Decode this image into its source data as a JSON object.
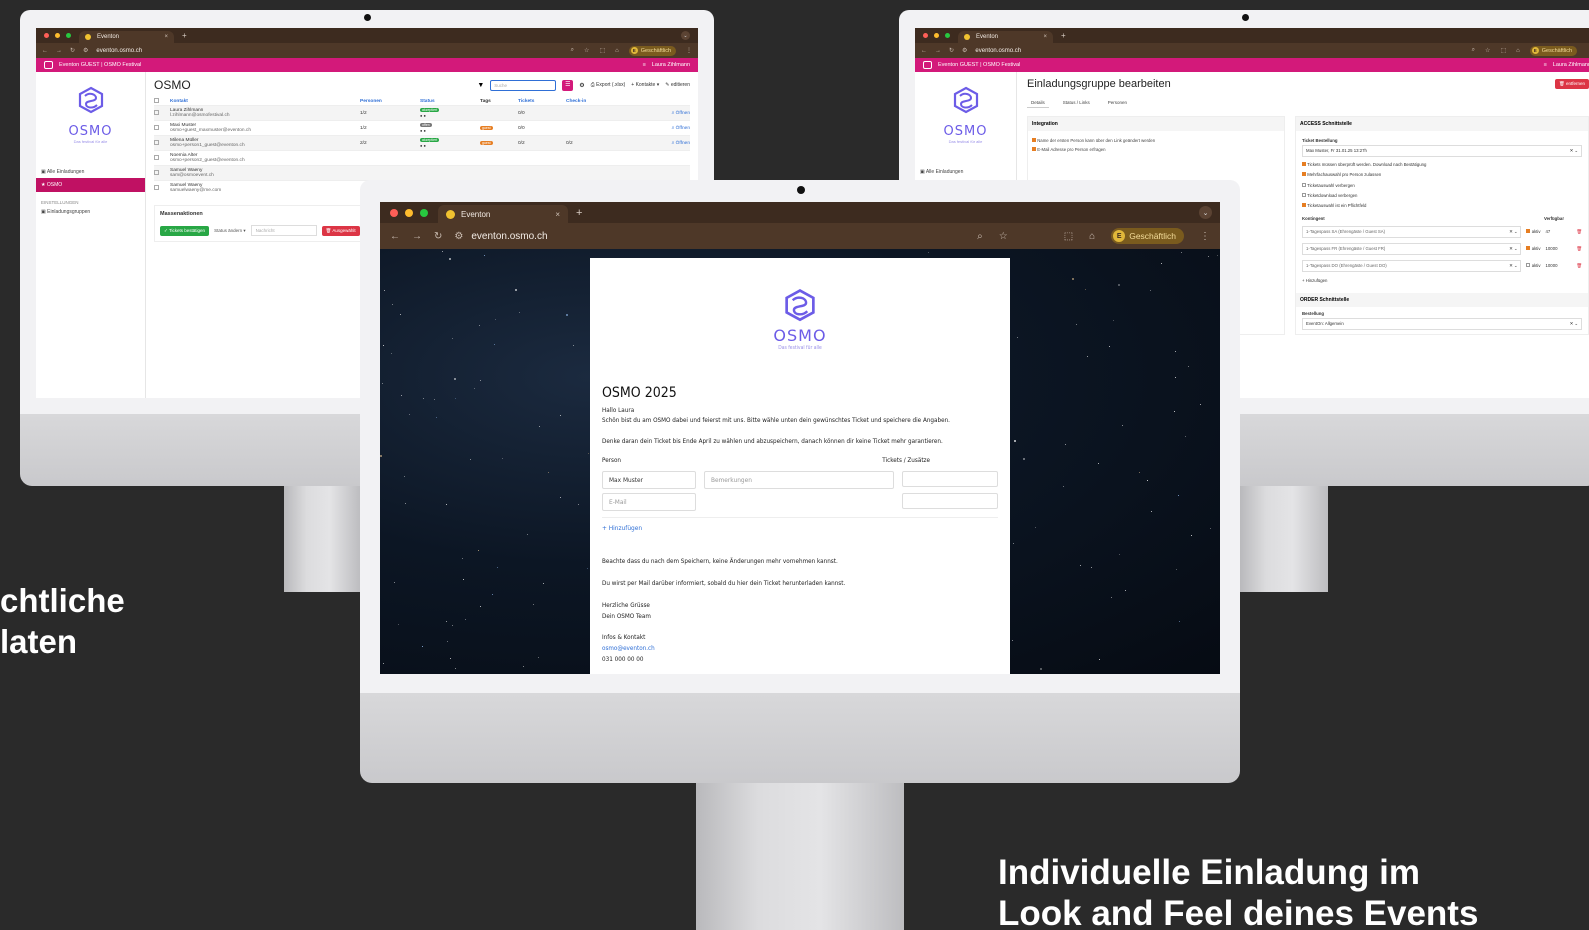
{
  "headlines": {
    "left_line1": "chtliche",
    "left_line2": "laten",
    "right_line1": "Individuelle Einladung im",
    "right_line2": "Look and Feel deines Events"
  },
  "browser": {
    "tab_title": "Eventon",
    "url": "eventon.osmo.ch",
    "profile_initial": "E",
    "profile_label": "Geschäftlich",
    "new_tab": "+",
    "close": "×"
  },
  "app": {
    "title": "Eventon GUEST | OSMO Festival",
    "user": "Laura Zihlmann",
    "logo_text": "OSMO",
    "logo_tagline": "Das festival für alle"
  },
  "left": {
    "menu": {
      "all_invites": "Alle Einladungen",
      "active_item": "OSMO",
      "settings_header": "EINSTELLUNGEN",
      "groups": "Einladungsgruppen"
    },
    "page_title": "OSMO",
    "search_placeholder": "Suche",
    "export_label": "Export (.xlsx)",
    "contacts_label": "Kontakte",
    "edit_label": "editieren",
    "columns": [
      "Kontakt",
      "Personen",
      "Status",
      "Tags",
      "Tickets",
      "Check-in"
    ],
    "rows": [
      {
        "name": "Laura Zihlmann",
        "email": "l.zihlmann@osmofestival.ch",
        "persons": "1/2",
        "status": "akzeptiert",
        "tag": "",
        "tickets": "0/0",
        "checkin": "",
        "action": "Öffnen"
      },
      {
        "name": "Maxi Muster",
        "email": "osmo+guest_maxmuster@eventon.ch",
        "persons": "1/2",
        "status": "offen",
        "tag": "guest",
        "tickets": "0/0",
        "checkin": "",
        "action": "Öffnen"
      },
      {
        "name": "Milena Müller",
        "email": "osmo+person1_guest@eventon.ch",
        "persons": "2/2",
        "status": "akzeptiert",
        "tag": "guest",
        "tickets": "0/2",
        "checkin": "0/2",
        "action": "Öffnen"
      },
      {
        "name": "Noemia Alter",
        "email": "osmo+person2_guest@eventon.ch",
        "persons": "",
        "status": "",
        "tag": "",
        "tickets": "",
        "checkin": "",
        "action": ""
      },
      {
        "name": "Samuel Waeny",
        "email": "sam@osmoevent.ch",
        "persons": "",
        "status": "",
        "tag": "",
        "tickets": "",
        "checkin": "",
        "action": ""
      },
      {
        "name": "Samuel Waeny",
        "email": "samuelwaeny@me.com",
        "persons": "",
        "status": "",
        "tag": "",
        "tickets": "",
        "checkin": "",
        "action": ""
      }
    ],
    "bulk_title": "Massenaktionen",
    "bulk_confirm": "Tickets bestätigen",
    "bulk_status": "Status ändern",
    "bulk_placeholder": "Nachricht",
    "bulk_delete": "Ausgewählt"
  },
  "right": {
    "menu_all": "Alle Einladungen",
    "page_title": "Einladungsgruppe bearbeiten",
    "remove_label": "entfernen",
    "tabs": [
      "Details",
      "Status / Links",
      "Personen"
    ],
    "integration_title": "Integration",
    "integration_opt1": "Name der ersten Person kann über den Link geändert werden",
    "integration_opt2": "E-Mail Adresse pro Person erfragen",
    "access_title": "ACCESS Schnittstelle",
    "ticket_order_label": "Ticket Bestellung",
    "ticket_order_value": "Max Muster, Fr 31.01.25 13:27h",
    "access_opts": [
      {
        "label": "Tickets müssen überprüft werden. Download nach Bestätigung",
        "checked": true
      },
      {
        "label": "Mehrfachauswahl pro Person zulassen",
        "checked": true
      },
      {
        "label": "Ticketauswahl verbergen",
        "checked": false
      },
      {
        "label": "Ticketdownload verbergen",
        "checked": false
      },
      {
        "label": "Ticketauswahl ist ein Pflichtfeld",
        "checked": true
      }
    ],
    "quota_col": "Kontingent",
    "avail_col": "Verfügbar",
    "quotas": [
      {
        "name": "1-Tagespass SA (Ehrengäste / Guest SA)",
        "active": true,
        "active_label": "aktiv",
        "avail": "47"
      },
      {
        "name": "1-Tagespass FR (Ehrengäste / Guest FR)",
        "active": true,
        "active_label": "aktiv",
        "avail": "10000"
      },
      {
        "name": "1-Tagespass DO (Ehrengäste / Guest DO)",
        "active": false,
        "active_label": "aktiv",
        "avail": "10000"
      }
    ],
    "add_label": "+ Hinzufügen",
    "order_title": "ORDER Schnittstelle",
    "order_label": "Bestellung",
    "order_value": "EventOn: Allgemein"
  },
  "invite": {
    "logo_text": "OSMO",
    "logo_tagline": "Das festival für alle",
    "title": "OSMO 2025",
    "greeting": "Hallo Laura",
    "intro": "Schön bist du am OSMO dabei und feierst mit uns. Bitte wähle unten dein gewünschtes Ticket und speichere die Angaben.",
    "deadline": "Denke daran dein Ticket bis Ende April zu wählen und abzuspeichern, danach können dir keine Ticket mehr garantieren.",
    "col_person": "Person",
    "col_tickets": "Tickets / Zusätze",
    "name_value": "Max Muster",
    "remarks_placeholder": "Bemerkungen",
    "email_placeholder": "E-Mail",
    "add_link": "+ Hinzufügen",
    "note_save": "Beachte dass du nach dem Speichern, keine Änderungen mehr vornehmen kannst.",
    "note_mail": "Du wirst per Mail darüber informiert, sobald du hier dein Ticket herunterladen kannst.",
    "regards": "Herzliche Grüsse",
    "team": "Dein OSMO Team",
    "contact_head": "Infos & Kontakt",
    "contact_email": "osmo@eventon.ch",
    "contact_phone": "031 000 00 00"
  },
  "colors": {
    "brand_pink": "#d3197a",
    "logo_purple": "#6c5ce7",
    "chrome_brown": "#3d2b1f",
    "space_dark": "#0c1624"
  }
}
